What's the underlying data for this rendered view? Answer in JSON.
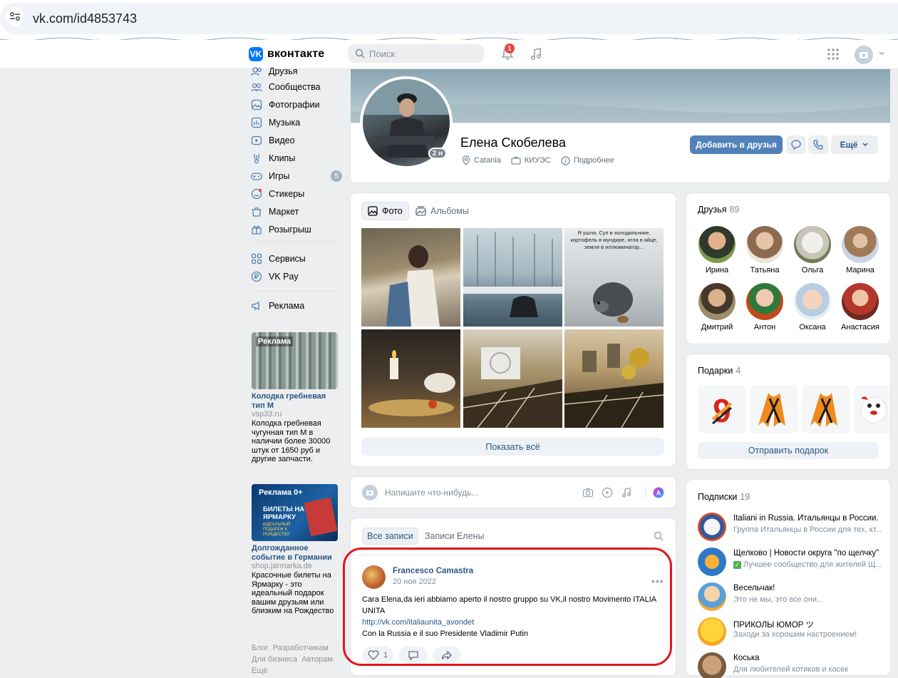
{
  "browser": {
    "url": "vk.com/id4853743"
  },
  "header": {
    "logo_text": "вконтакте",
    "search_placeholder": "Поиск",
    "notifications_count": "1"
  },
  "menu": {
    "items": [
      {
        "label": "Друзья",
        "icon": "friends-icon"
      },
      {
        "label": "Сообщества",
        "icon": "communities-icon"
      },
      {
        "label": "Фотографии",
        "icon": "photos-icon"
      },
      {
        "label": "Музыка",
        "icon": "music-icon"
      },
      {
        "label": "Видео",
        "icon": "video-icon"
      },
      {
        "label": "Клипы",
        "icon": "clips-icon"
      },
      {
        "label": "Игры",
        "icon": "games-icon",
        "badge": "5"
      },
      {
        "label": "Стикеры",
        "icon": "stickers-icon"
      },
      {
        "label": "Маркет",
        "icon": "market-icon"
      },
      {
        "label": "Розыгрыш",
        "icon": "gift-icon"
      },
      {
        "label": "Сервисы",
        "icon": "services-icon"
      },
      {
        "label": "VK Pay",
        "icon": "vkpay-icon"
      },
      {
        "label": "Реклама",
        "icon": "ads-icon"
      }
    ]
  },
  "ads": [
    {
      "tag": "Реклама",
      "title": "Колодка гребневая тип М",
      "domain": "vsp33.ru",
      "text": "Колодка гребневая чугунная тип М в наличии более 30000 штук от 1650 руб и другие запчасти."
    },
    {
      "tag": "Реклама 0+",
      "banner_title": "БИЛЕТЫ НА ЯРМАРКУ",
      "banner_sub": "ИДЕАЛЬНЫЙ ПОДАРОК К РОЖДЕСТВУ",
      "title": "Долгожданное событие в Германии",
      "domain": "shop.jarmarka.de",
      "text": "Красочные билеты на Ярмарку - это идеальный подарок вашим друзьям или близким на Рождество"
    }
  ],
  "footer": {
    "blog": "Блог",
    "developers": "Разработчикам",
    "business": "Для бизнеса",
    "authors": "Авторам",
    "more": "Ещё"
  },
  "profile": {
    "name": "Елена Скобелева",
    "online_badge": "2 н",
    "city": "Catania",
    "work": "КИУЭС",
    "details": "Подробнее",
    "add_friend": "Добавить в друзья",
    "more": "Ещё"
  },
  "photos": {
    "tab_photos": "Фото",
    "tab_albums": "Альбомы",
    "meme_text": "Я ушла. Суп в холодильнике, картофель в мундире, игла в яйце, земля в иллюминатор...",
    "show_all": "Показать всё"
  },
  "composer": {
    "placeholder": "Напишите что-нибудь..."
  },
  "wall": {
    "tab_all": "Все записи",
    "tab_own": "Записи Елены",
    "post": {
      "author": "Francesco Camastra",
      "date": "20 ноя 2022",
      "line1": "Cara Elena,da ieri abbiamo aperto il nostro gruppo su VK,il nostro Movimento ITALIA UNITA",
      "link": "http://vk.com/italiaunita_avondet",
      "line3": "Con la Russia e il suo Presidente Vladimir Putin",
      "likes": "1"
    }
  },
  "friends": {
    "title": "Друзья",
    "count": "89",
    "list": [
      "Ирина",
      "Татьяна",
      "Ольга",
      "Марина",
      "Дмитрий",
      "Антон",
      "Оксана",
      "Анастасия"
    ]
  },
  "gifts": {
    "title": "Подарки",
    "count": "4",
    "send": "Отправить подарок"
  },
  "subscriptions": {
    "title": "Подписки",
    "count": "19",
    "list": [
      {
        "name": "Italiani in Russia. Итальянцы в России.",
        "desc": "Группа Итальянцы в России для тех, кт..."
      },
      {
        "name": "Щелково | Новости округа \"по щелчку\"",
        "desc": "Лучшее сообщество для жителей Щ..."
      },
      {
        "name": "Весельчак!",
        "desc": "Это не мы, это все они..."
      },
      {
        "name": "ПРИКОЛЫ ЮМОР ツ",
        "desc": "Заходи за хорошим настроением!"
      },
      {
        "name": "Коська",
        "desc": "Для любителей котиков и косек"
      }
    ]
  },
  "colors": {
    "accent": "#5181b8",
    "link": "#2a5885",
    "red_frame": "#e0171d",
    "badge": "#e64646"
  }
}
